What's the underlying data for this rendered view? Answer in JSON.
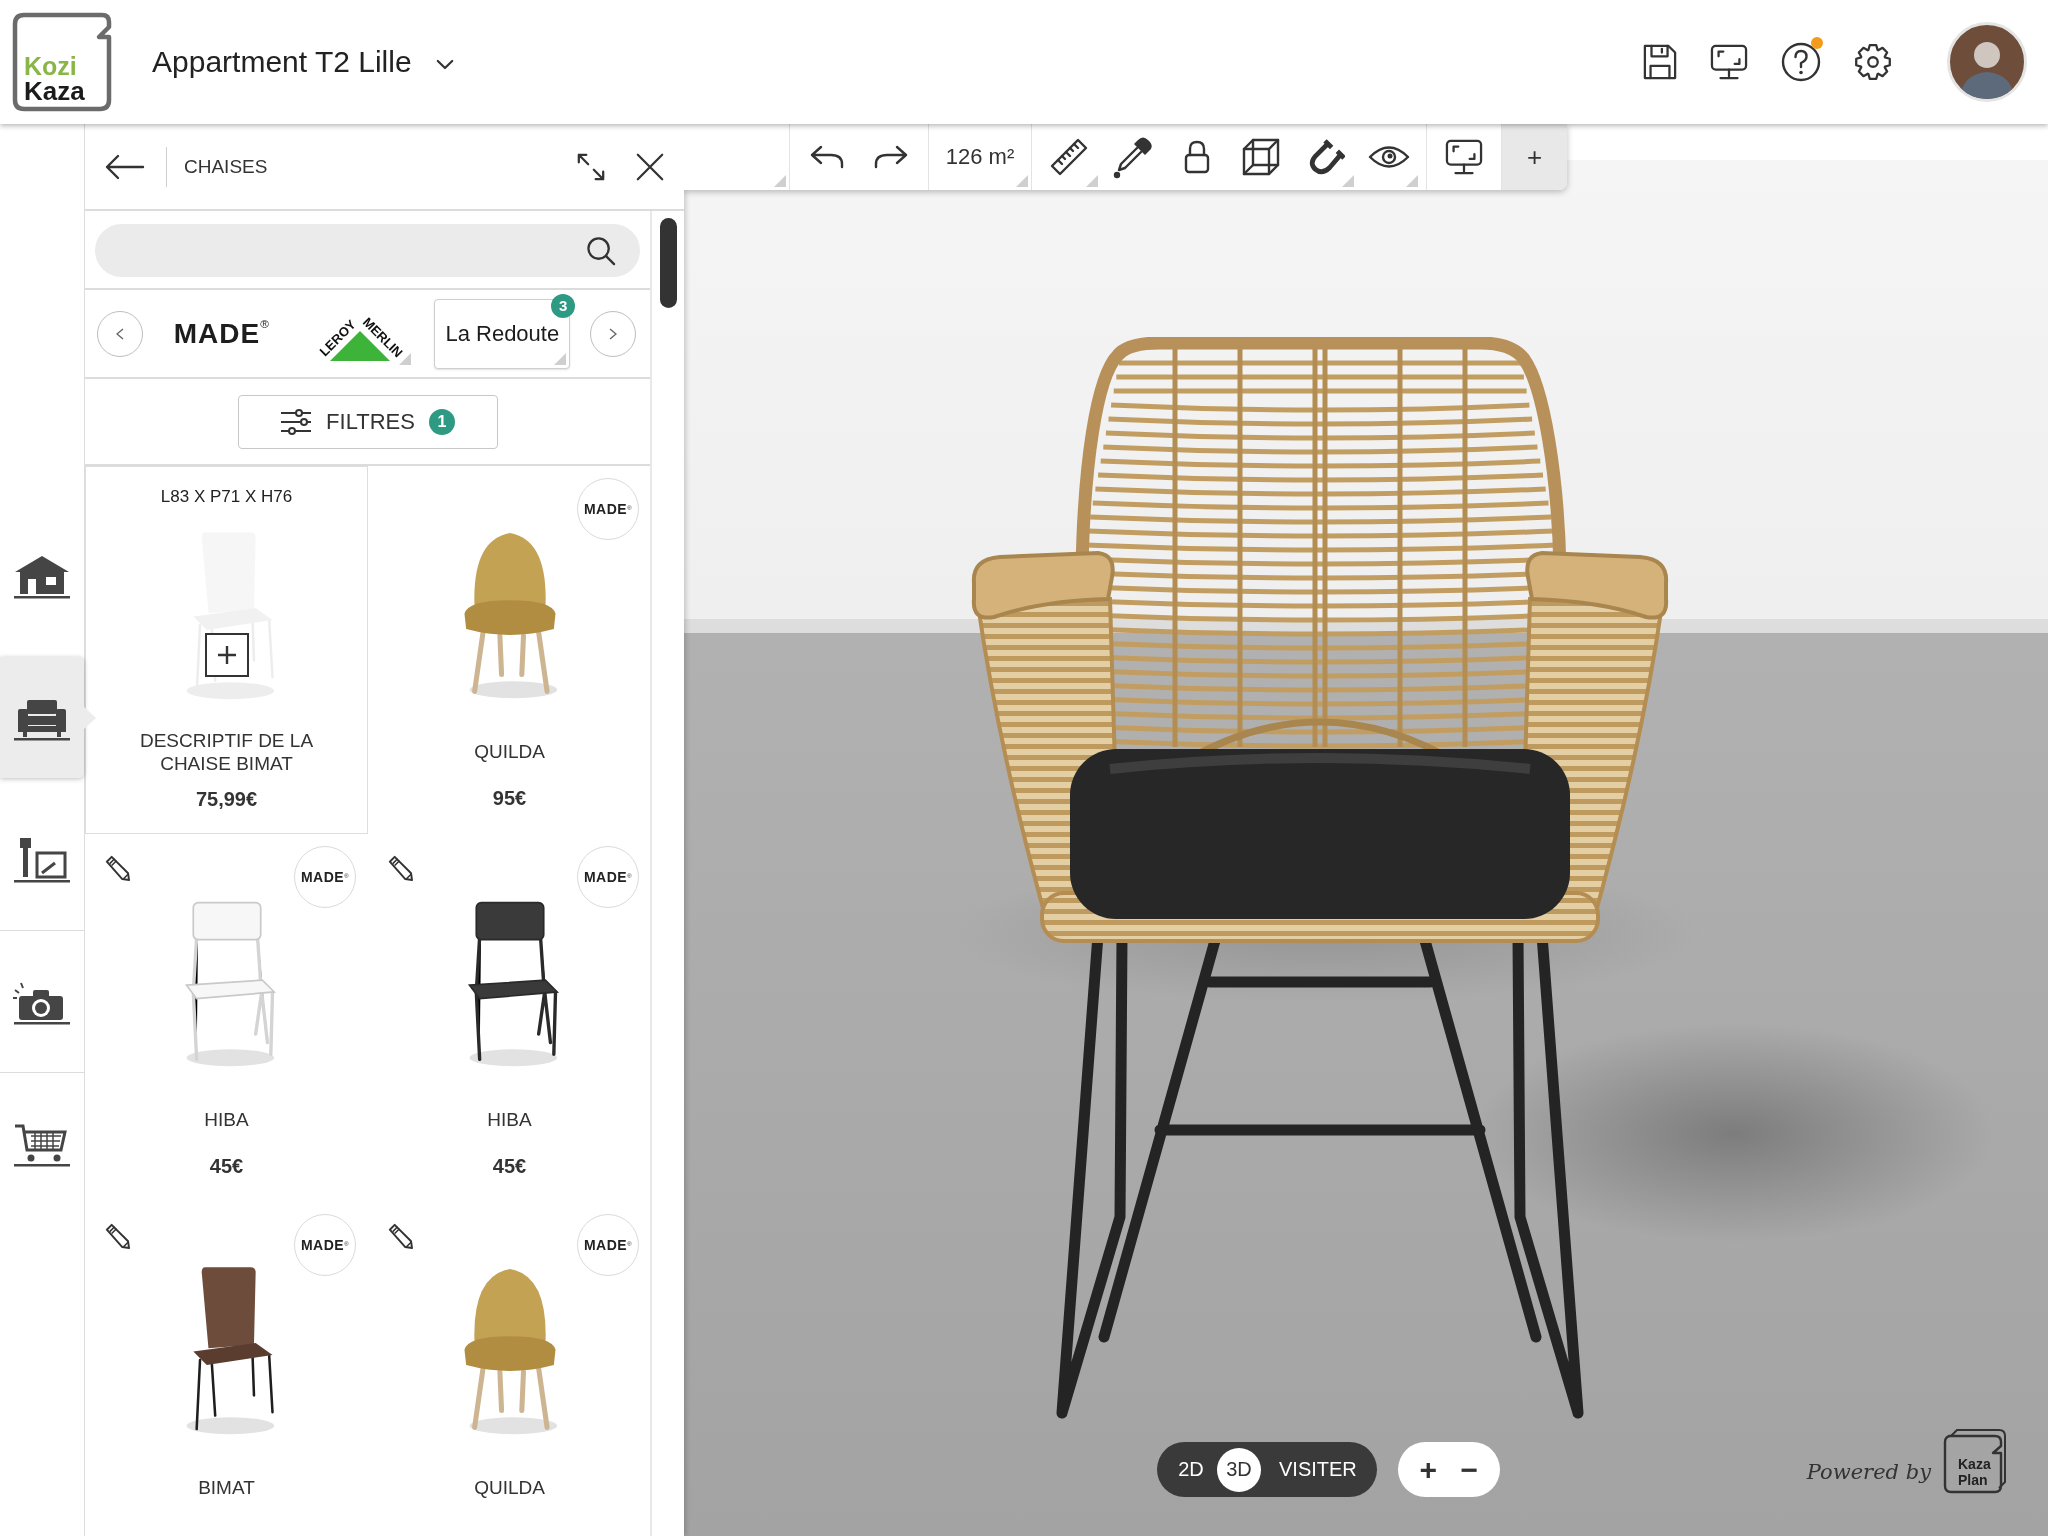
{
  "header": {
    "logo": {
      "line_1": "Kozi",
      "line_2": "Kaza"
    },
    "project_title": "Appartment T2 Lille",
    "help_notification": true
  },
  "sidebar": {
    "items": [
      {
        "kind": "house",
        "selected": false
      },
      {
        "kind": "sofa",
        "selected": true
      },
      {
        "kind": "tools",
        "selected": false
      },
      {
        "kind": "camera",
        "selected": false
      },
      {
        "kind": "cart",
        "selected": false
      }
    ]
  },
  "catalog_panel": {
    "title": "CHAISES",
    "brands": [
      {
        "kind": "wordmark",
        "name": "MADE$^{®}$",
        "selected": false,
        "has_menu": false
      },
      {
        "kind": "triangle",
        "lines": [
          "LEROY",
          "MERLIN"
        ],
        "selected": false,
        "has_menu": true
      },
      {
        "kind": "text",
        "name": "La Redoute",
        "badge": "3",
        "selected": true,
        "has_menu": true
      }
    ],
    "filters": {
      "label": "FILTRES",
      "count": "1"
    },
    "products": [
      {
        "kind": "hover",
        "dimensions": "L83 X P71 X H76",
        "name": "DESCRIPTIF DE LA CHAISE BIMAT",
        "price": "75,99€",
        "editable": false
      },
      {
        "kind": "product",
        "name": "QUILDA",
        "price": "95€",
        "badge": "MADE$^{®}$",
        "editable": false
      },
      {
        "kind": "product",
        "name": "HIBA",
        "price": "45€",
        "badge": "MADE$^{®}$",
        "editable": true
      },
      {
        "kind": "product",
        "name": "HIBA",
        "price": "45€",
        "badge": "MADE$^{®}$",
        "editable": true
      },
      {
        "kind": "product",
        "name": "BIMAT",
        "badge": "MADE$^{®}$",
        "editable": true
      },
      {
        "kind": "product",
        "name": "QUILDA",
        "badge": "MADE$^{®}$",
        "editable": true
      }
    ]
  },
  "toolbar": {
    "groups": [
      [
        {
          "kind": "blank",
          "has_menu": true
        }
      ],
      [
        {
          "kind": "undo",
          "has_menu": false
        },
        {
          "kind": "redo",
          "has_menu": false
        }
      ],
      [
        {
          "kind": "text",
          "label": "126 m²",
          "has_menu": true
        }
      ],
      [
        {
          "kind": "ruler",
          "has_menu": true
        },
        {
          "kind": "eyedropper",
          "has_menu": false
        },
        {
          "kind": "lock",
          "has_menu": false
        },
        {
          "kind": "cube",
          "has_menu": false
        },
        {
          "kind": "magnet",
          "has_menu": true
        },
        {
          "kind": "eye",
          "has_menu": true
        }
      ],
      [
        {
          "kind": "monitor",
          "has_menu": false
        }
      ],
      [
        {
          "kind": "add",
          "label": "+",
          "has_menu": false
        }
      ]
    ]
  },
  "view_modes": [
    {
      "label": "2D",
      "selected": false
    },
    {
      "label": "3D",
      "selected": true
    },
    {
      "label": "VISITER",
      "selected": false
    }
  ],
  "zoom": {
    "zoom_in": "+",
    "zoom_out": "−"
  },
  "powered_by": {
    "label": "Powered by",
    "logo_line_1": "Kaza",
    "logo_line_2": "Plan"
  }
}
